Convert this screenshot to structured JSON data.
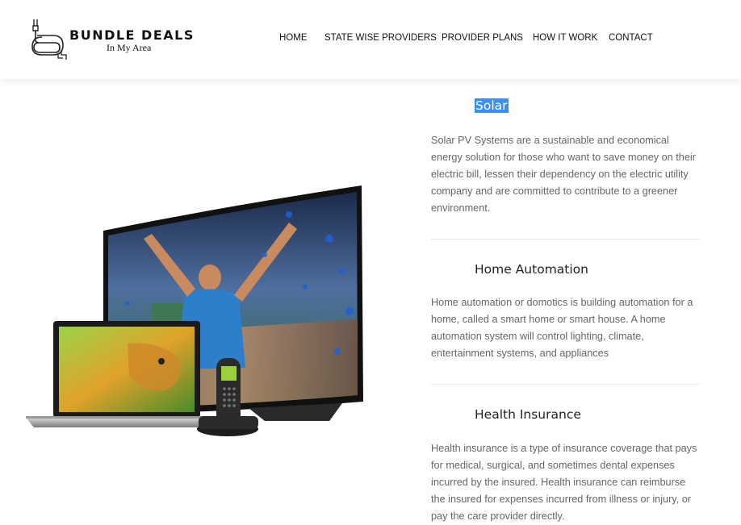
{
  "logo": {
    "title": "BUNDLE DEALS",
    "subtitle": "In My Area"
  },
  "nav": [
    {
      "label": "HOME"
    },
    {
      "label": "STATE WISE PROVIDERS"
    },
    {
      "label": "PROVIDER PLANS"
    },
    {
      "label": "HOW IT WORK"
    },
    {
      "label": "CONTACT"
    }
  ],
  "sections": [
    {
      "title": "Solar",
      "text": "Solar PV Systems are a sustainable and economical energy solution for those who want to save money on their electric bill, lessen their dependency on the electric utility company and are committed to contribute to a greener environment."
    },
    {
      "title": "Home Automation",
      "text": "Home automation or domotics is building automation for a home, called a smart home or smart house. A home automation system will control lighting, climate, entertainment systems, and appliances"
    },
    {
      "title": "Health Insurance",
      "text": "Health insurance is a type of insurance coverage that pays for medical, surgical, and sometimes dental expenses incurred by the insured. Health insurance can reimburse the insured for expenses incurred from illness or injury, or pay the care provider directly."
    }
  ]
}
